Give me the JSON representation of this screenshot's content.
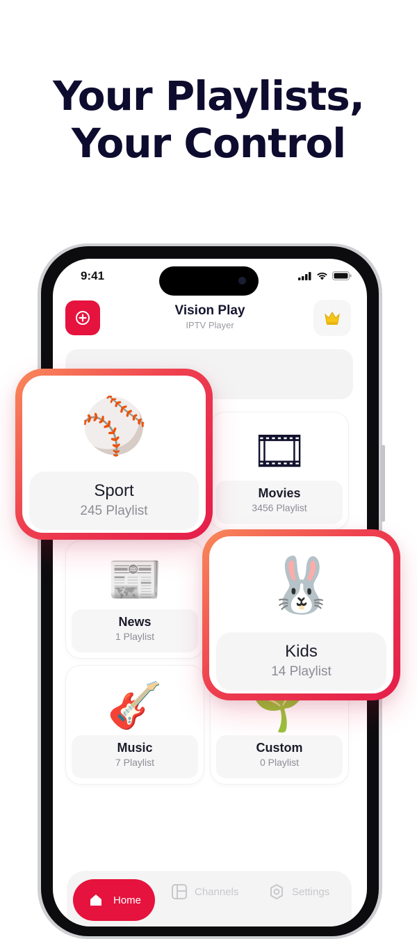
{
  "headline": {
    "line1": "Your Playlists,",
    "line2": "Your Control"
  },
  "status": {
    "time": "9:41"
  },
  "app": {
    "title": "Vision Play",
    "subtitle": "IPTV Player"
  },
  "accent": "#e5133d",
  "categories": [
    {
      "name": "Sport",
      "count": "245 Playlist",
      "icon": "baseball-player-icon",
      "highlighted": true
    },
    {
      "name": "Movies",
      "count": "3456 Playlist",
      "icon": "film-projector-icon",
      "highlighted": false
    },
    {
      "name": "News",
      "count": "1 Playlist",
      "icon": "newspaper-icon",
      "highlighted": false
    },
    {
      "name": "Kids",
      "count": "14 Playlist",
      "icon": "bunny-icon",
      "highlighted": true
    },
    {
      "name": "Music",
      "count": "7 Playlist",
      "icon": "guitar-icon",
      "highlighted": false
    },
    {
      "name": "Custom",
      "count": "0 Playlist",
      "icon": "plant-icon",
      "highlighted": false
    }
  ],
  "tabs": {
    "home": "Home",
    "channels": "Channels",
    "settings": "Settings"
  }
}
